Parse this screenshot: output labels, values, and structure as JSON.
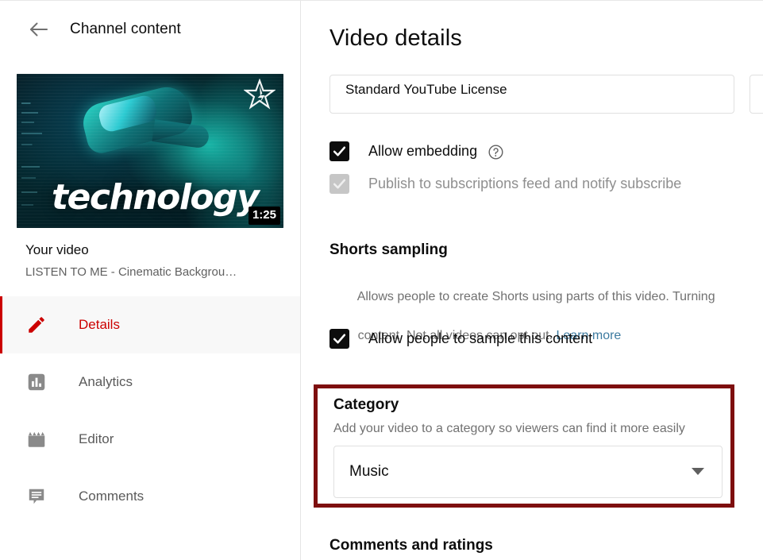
{
  "sidebar": {
    "back_icon": "back-arrow-icon",
    "title": "Channel content",
    "video": {
      "thumbnail_text": "technology",
      "duration": "1:25",
      "watermark_icon": "star-icon",
      "label": "Your video",
      "name": "LISTEN TO ME - Cinematic Backgrou…"
    },
    "nav_items": [
      {
        "label": "Details",
        "icon": "pencil-icon",
        "active": true
      },
      {
        "label": "Analytics",
        "icon": "bar-chart-icon",
        "active": false
      },
      {
        "label": "Editor",
        "icon": "clapperboard-icon",
        "active": false
      },
      {
        "label": "Comments",
        "icon": "comment-icon",
        "active": false
      }
    ]
  },
  "main": {
    "title": "Video details",
    "license": {
      "value": "Standard YouTube License"
    },
    "allow_embedding": {
      "label": "Allow embedding",
      "checked": true,
      "help_icon": "question-mark-circle-icon"
    },
    "publish_subscriptions": {
      "label": "Publish to subscriptions feed and notify subscribe",
      "checked": true,
      "disabled": true
    },
    "shorts_sampling": {
      "title": "Shorts sampling",
      "description_line1": "Allows people to create Shorts using parts of this video. Turning",
      "description_line2_prefix": "content. Not all videos can opt out. ",
      "learn_more": "Learn more",
      "checkbox_label": "Allow people to sample this content",
      "checked": true
    },
    "category": {
      "title": "Category",
      "description": "Add your video to a category so viewers can find it more easily",
      "selected": "Music",
      "dropdown_icon": "chevron-down-icon",
      "highlight_color": "#7e0f0f"
    },
    "comments_and_ratings": {
      "title": "Comments and ratings"
    }
  },
  "colors": {
    "brand_red": "#cc0000",
    "highlight_red": "#7e0f0f",
    "link_blue": "#3d7ba0",
    "muted_text": "#717171"
  }
}
